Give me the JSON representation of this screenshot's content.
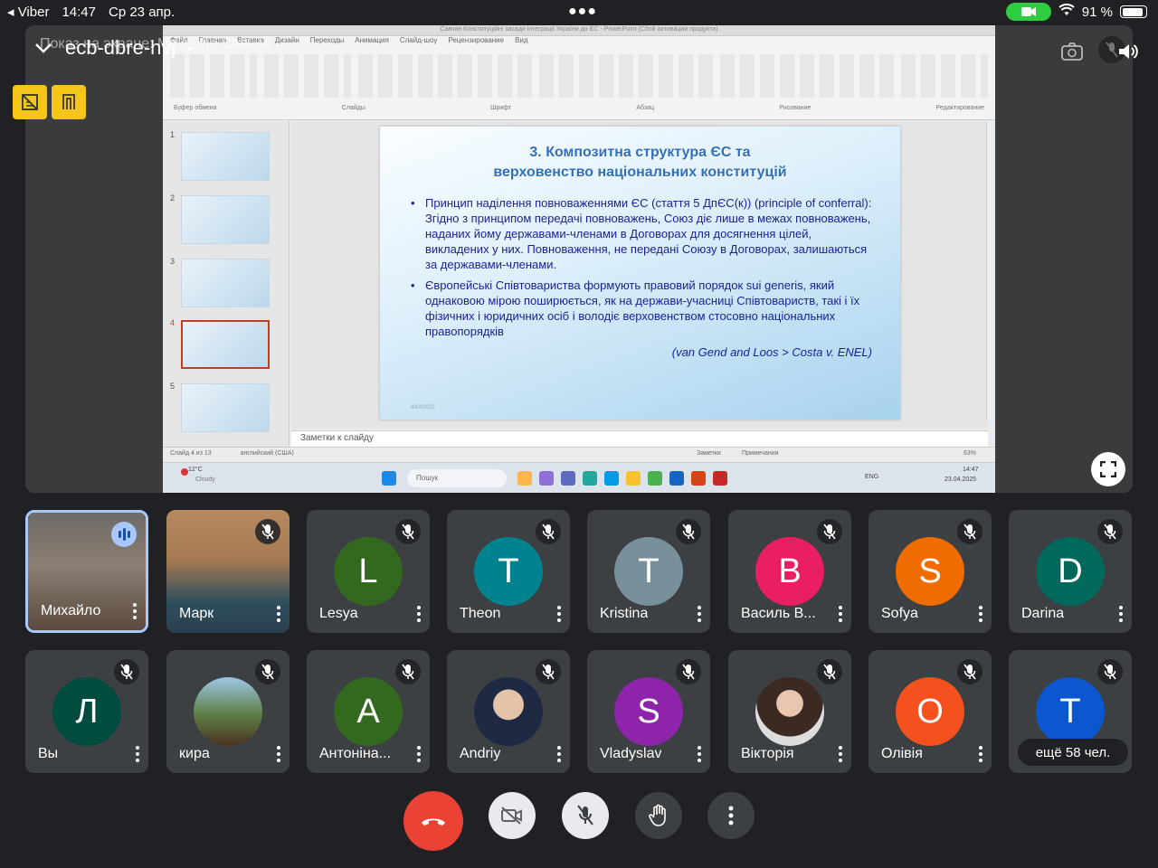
{
  "status_bar": {
    "back_app": "Viber",
    "time": "14:47",
    "date": "Ср 23 апр.",
    "battery": "91 %",
    "battery_level": 0.91
  },
  "meeting": {
    "code": "ecb-dbre-hvj",
    "presenting_banner": "Показ на экране: Михайло Савчин"
  },
  "presentation": {
    "window_title": "Савчин Конституційні засади інтеграції України до ЄС - PowerPoint (Сбой активации продукта)",
    "ribbon_tabs": [
      "Файл",
      "Главная",
      "Вставка",
      "Дизайн",
      "Переходы",
      "Анимация",
      "Слайд-шоу",
      "Рецензирование",
      "Вид"
    ],
    "ribbon_groups": [
      "Буфер обмена",
      "Слайды",
      "Шрифт",
      "Абзац",
      "Рисование",
      "Редактирование"
    ],
    "slide": {
      "title_line1": "3. Композитна структура ЄС та",
      "title_line2": "верховенство національних конституцій",
      "bullet1": "Принцип наділення повноваженнями ЄС (стаття 5 ДпЄС(к)) (principle of conferral): Згідно з принципом передачі повноважень, Союз діє лише в межах повноважень, наданих йому державами-членами в Договорах для досягнення цілей, викладених у них. Повноваження, не передані Союзу в Договорах, залишаються за державами-членами.",
      "bullet2": "Європейські Співтовариства формують правовий порядок sui generis, який однаковою мірою поширюється, як на держави-учасниці Співтовариств, такі і їх фізичних і юридичних осіб і володіє верховенством стосовно національних правопорядків",
      "reference": "(van Gend and Loos > Costa v. ENEL)",
      "date": "4/10/2025"
    },
    "thumb_numbers": [
      "1",
      "2",
      "3",
      "4",
      "5"
    ],
    "notes_placeholder": "Заметки к слайду",
    "status_left": "Слайд 4 из 13",
    "status_lang": "английский (США)",
    "status_notes": "Заметки",
    "status_comments": "Примечания",
    "zoom": "63%",
    "taskbar": {
      "weather_temp": "12°C",
      "weather_desc": "Cloudy",
      "search": "Пошук",
      "lang": "ENG",
      "clock_time": "14:47",
      "clock_date": "23.04.2025"
    }
  },
  "participants_row1": [
    {
      "name": "Михайло",
      "state": "speaking",
      "kind": "video"
    },
    {
      "name": "Марк",
      "state": "muted",
      "kind": "video"
    },
    {
      "name": "Lesya",
      "initial": "L",
      "color": "#33691e",
      "state": "muted"
    },
    {
      "name": "Theon",
      "initial": "T",
      "color": "#00838f",
      "state": "muted"
    },
    {
      "name": "Kristina",
      "initial": "T",
      "color": "#78909c",
      "state": "muted"
    },
    {
      "name": "Василь В...",
      "initial": "В",
      "color": "#e91e63",
      "state": "muted"
    },
    {
      "name": "Sofya",
      "initial": "S",
      "color": "#ef6c00",
      "state": "muted"
    },
    {
      "name": "Darina",
      "initial": "D",
      "color": "#00695c",
      "state": "muted"
    }
  ],
  "participants_row2": [
    {
      "name": "Вы",
      "initial": "Л",
      "color": "#004d40",
      "state": "muted"
    },
    {
      "name": "кира",
      "state": "muted",
      "kind": "photo"
    },
    {
      "name": "Антоніна...",
      "initial": "А",
      "color": "#33691e",
      "state": "muted"
    },
    {
      "name": "Andriy",
      "state": "muted",
      "kind": "photo"
    },
    {
      "name": "Vladyslav",
      "initial": "S",
      "color": "#8e24aa",
      "state": "muted"
    },
    {
      "name": "Вікторія",
      "state": "muted",
      "kind": "photo"
    },
    {
      "name": "Олівія",
      "initial": "O",
      "color": "#f4511e",
      "state": "muted"
    },
    {
      "name": "",
      "initial": "T",
      "color": "#0b57d0",
      "state": "muted"
    }
  ],
  "more_participants": "ещё 58 чел.",
  "controls": {
    "end_call": "end-call",
    "camera": "camera-off",
    "mic": "mic-off",
    "raise_hand": "raise-hand",
    "more": "more-options"
  },
  "colors": {
    "background": "#202124",
    "tile": "#3c4043",
    "end_call": "#ea4335",
    "active_speaker": "#a8c7fa",
    "control_badge": "#f5c518"
  }
}
